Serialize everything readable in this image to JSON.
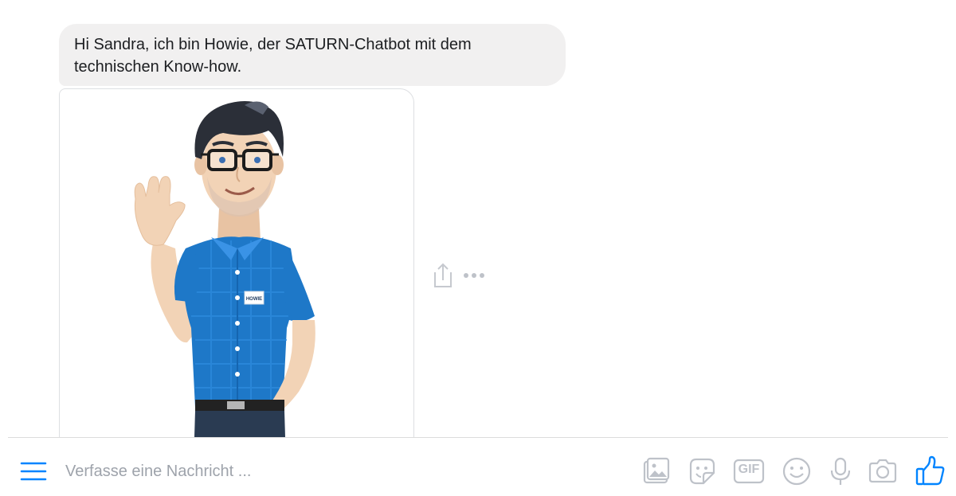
{
  "conversation": {
    "bot_message": "Hi Sandra, ich bin Howie, der SATURN-Chatbot mit dem technischen Know-how.",
    "image": {
      "icon": "howie-mascot-waving",
      "name_tag": "HOWIE"
    },
    "message_actions": {
      "share_icon": "share-icon",
      "more_icon": "more-options-icon"
    }
  },
  "composer": {
    "menu_icon": "hamburger-menu-icon",
    "placeholder": "Verfasse eine Nachricht ...",
    "value": "",
    "tools": [
      {
        "name": "photo-icon"
      },
      {
        "name": "sticker-icon"
      },
      {
        "name": "gif-icon",
        "label": "GIF"
      },
      {
        "name": "emoji-icon"
      },
      {
        "name": "microphone-icon"
      },
      {
        "name": "camera-icon"
      },
      {
        "name": "like-icon"
      }
    ]
  },
  "colors": {
    "accent": "#0084ff",
    "icon_gray": "#bec2c9",
    "bubble_bg": "#f1f0f0",
    "shirt_blue": "#1e78c8"
  }
}
